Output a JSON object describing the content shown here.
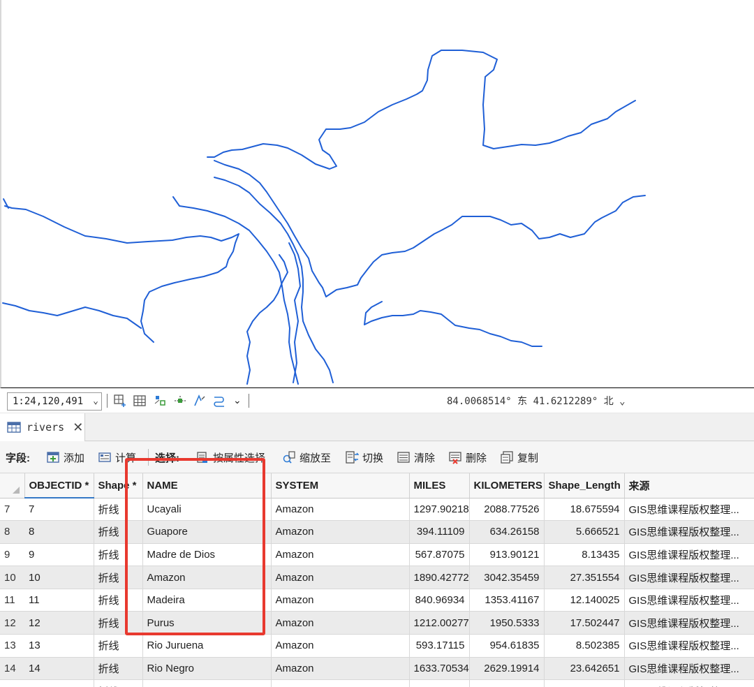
{
  "status": {
    "scale": "1:24,120,491",
    "coordinates": "84.0068514° 东 41.6212289° 北"
  },
  "tab": {
    "title": "rivers"
  },
  "toolbar": {
    "fields_label": "字段:",
    "add": "添加",
    "calculate": "计算",
    "select_label": "选择:",
    "select_by_attributes": "按属性选择",
    "zoom_to": "缩放至",
    "switch": "切换",
    "clear": "清除",
    "delete": "删除",
    "copy": "复制"
  },
  "table": {
    "columns": [
      "OBJECTID *",
      "Shape *",
      "NAME",
      "SYSTEM",
      "MILES",
      "KILOMETERS",
      "Shape_Length",
      "来源"
    ],
    "rows": [
      {
        "row": "7",
        "objectid": "7",
        "shape": "折线",
        "name": "Ucayali",
        "system": "Amazon",
        "miles": "1297.90218",
        "km": "2088.77526",
        "length": "18.675594",
        "source": "GIS思维课程版权整理..."
      },
      {
        "row": "8",
        "objectid": "8",
        "shape": "折线",
        "name": "Guapore",
        "system": "Amazon",
        "miles": "394.11109",
        "km": "634.26158",
        "length": "5.666521",
        "source": "GIS思维课程版权整理..."
      },
      {
        "row": "9",
        "objectid": "9",
        "shape": "折线",
        "name": "Madre de Dios",
        "system": "Amazon",
        "miles": "567.87075",
        "km": "913.90121",
        "length": "8.13435",
        "source": "GIS思维课程版权整理..."
      },
      {
        "row": "10",
        "objectid": "10",
        "shape": "折线",
        "name": "Amazon",
        "system": "Amazon",
        "miles": "1890.42772",
        "km": "3042.35459",
        "length": "27.351554",
        "source": "GIS思维课程版权整理..."
      },
      {
        "row": "11",
        "objectid": "11",
        "shape": "折线",
        "name": "Madeira",
        "system": "Amazon",
        "miles": "840.96934",
        "km": "1353.41167",
        "length": "12.140025",
        "source": "GIS思维课程版权整理..."
      },
      {
        "row": "12",
        "objectid": "12",
        "shape": "折线",
        "name": "Purus",
        "system": "Amazon",
        "miles": "1212.00277",
        "km": "1950.5333",
        "length": "17.502447",
        "source": "GIS思维课程版权整理..."
      },
      {
        "row": "13",
        "objectid": "13",
        "shape": "折线",
        "name": "Rio Juruena",
        "system": "Amazon",
        "miles": "593.17115",
        "km": "954.61835",
        "length": "8.502385",
        "source": "GIS思维课程版权整理..."
      },
      {
        "row": "14",
        "objectid": "14",
        "shape": "折线",
        "name": "Rio Negro",
        "system": "Amazon",
        "miles": "1633.70534",
        "km": "2629.19914",
        "length": "23.642651",
        "source": "GIS思维课程版权整理..."
      },
      {
        "row": "",
        "objectid": "",
        "shape": "折线",
        "name": "",
        "system": "",
        "miles": "",
        "km": "",
        "length": "",
        "source": "GIS思维课程版权整理..."
      }
    ]
  },
  "colors": {
    "river": "#1f5fd6",
    "highlight": "#e8392f",
    "accent": "#3478c6"
  }
}
